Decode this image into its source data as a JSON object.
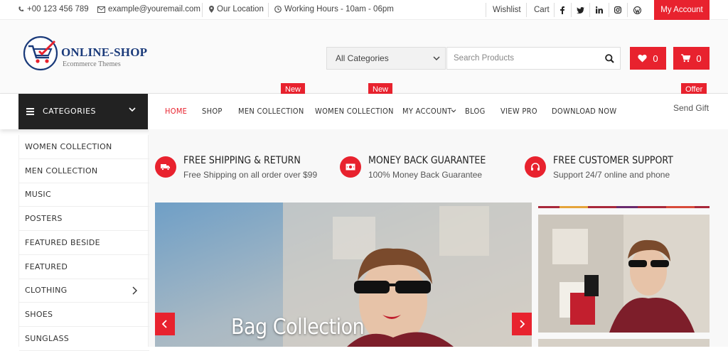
{
  "topbar": {
    "phone": "+00 123 456 789",
    "email": "example@youremail.com",
    "location": "Our Location",
    "hours": "Working Hours - 10am - 06pm",
    "wishlist": "Wishlist",
    "cart": "Cart",
    "social_icons": [
      "facebook-icon",
      "twitter-icon",
      "linkedin-icon",
      "instagram-icon",
      "wordpress-icon"
    ],
    "my_account": "My Account"
  },
  "header": {
    "logo_title": "ONLINE-SHOP",
    "logo_subtitle": "Ecommerce Themes",
    "category_select": "All Categories",
    "search_placeholder": "Search Products",
    "wishlist_count": "0",
    "cart_count": "0"
  },
  "nav": {
    "categories_label": "CATEGORIES",
    "items": [
      "HOME",
      "SHOP",
      "MEN COLLECTION",
      "WOMEN COLLECTION",
      "MY ACCOUNT",
      "BLOG",
      "VIEW PRO",
      "DOWNLOAD NOW"
    ],
    "active": "HOME",
    "badge_new": "New",
    "badge_offer": "Offer",
    "send_gift": "Send Gift"
  },
  "sidebar": {
    "items": [
      "WOMEN COLLECTION",
      "MEN COLLECTION",
      "MUSIC",
      "POSTERS",
      "FEATURED BESIDE",
      "FEATURED",
      "CLOTHING",
      "SHOES",
      "SUNGLASS"
    ]
  },
  "features": [
    {
      "title": "FREE SHIPPING & RETURN",
      "subtitle": "Free Shipping on all order over $99",
      "icon": "truck-icon"
    },
    {
      "title": "MONEY BACK GUARANTEE",
      "subtitle": "100% Money Back Guarantee",
      "icon": "money-icon"
    },
    {
      "title": "FREE CUSTOMER SUPPORT",
      "subtitle": "Support 24/7 online and phone",
      "icon": "headset-icon"
    }
  ],
  "slider": {
    "title": "Bag Collection"
  },
  "colors": {
    "accent": "#e8222e",
    "dark": "#222222",
    "logo_blue": "#1a3a7a"
  }
}
